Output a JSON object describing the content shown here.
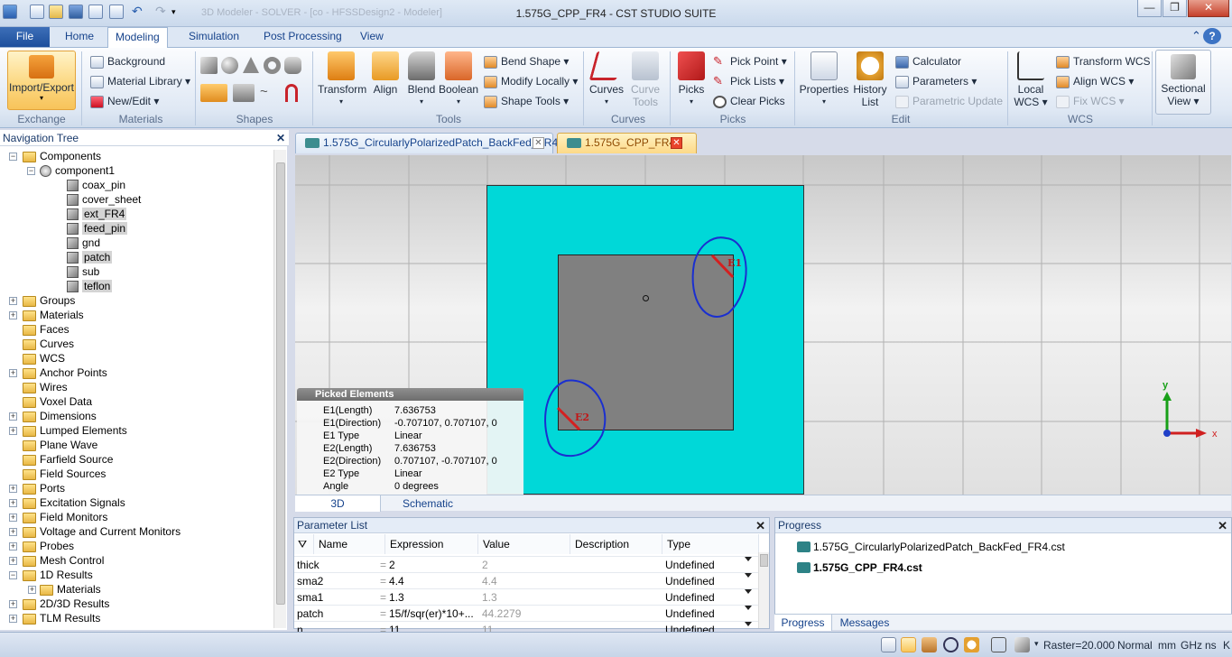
{
  "window": {
    "title": "1.575G_CPP_FR4 - CST STUDIO SUITE",
    "ghost_title": "3D Modeler - SOLVER - [co - HFSSDesign2 - Modeler]",
    "min": "—",
    "max": "❐",
    "close": "✕"
  },
  "ribbon_tabs": [
    "File",
    "Home",
    "Modeling",
    "Simulation",
    "Post Processing",
    "View"
  ],
  "ribbon_right": {
    "collapse": "⌃",
    "help": "?"
  },
  "ribbon": {
    "exchange": {
      "import_export": "Import/Export",
      "label": "Exchange"
    },
    "materials": {
      "background": "Background",
      "material_library": "Material Library",
      "new_edit": "New/Edit",
      "label": "Materials"
    },
    "shapes": {
      "label": "Shapes"
    },
    "tools": {
      "transform": "Transform",
      "align": "Align",
      "blend": "Blend",
      "boolean": "Boolean",
      "bend_shape": "Bend Shape",
      "modify_locally": "Modify Locally",
      "shape_tools": "Shape Tools",
      "label": "Tools"
    },
    "curves": {
      "curves": "Curves",
      "curve_tools_1": "Curve",
      "curve_tools_2": "Tools",
      "label": "Curves"
    },
    "picks": {
      "picks": "Picks",
      "pick_point": "Pick Point",
      "pick_lists": "Pick Lists",
      "clear_picks": "Clear Picks",
      "label": "Picks"
    },
    "edit": {
      "properties": "Properties",
      "history_list_1": "History",
      "history_list_2": "List",
      "calculator": "Calculator",
      "parameters": "Parameters",
      "parametric_update": "Parametric Update",
      "label": "Edit"
    },
    "wcs": {
      "local_wcs_1": "Local",
      "local_wcs_2": "WCS",
      "transform_wcs": "Transform WCS",
      "align_wcs": "Align WCS",
      "fix_wcs": "Fix WCS",
      "label": "WCS"
    },
    "sectional": {
      "l1": "Sectional",
      "l2": "View"
    }
  },
  "nav_tree": {
    "title": "Navigation Tree",
    "close": "✕",
    "components": "Components",
    "component1": "component1",
    "solids": [
      "coax_pin",
      "cover_sheet",
      "ext_FR4",
      "feed_pin",
      "gnd",
      "patch",
      "sub",
      "teflon"
    ],
    "folders": [
      "Groups",
      "Materials",
      "Faces",
      "Curves",
      "WCS",
      "Anchor Points",
      "Wires",
      "Voxel Data",
      "Dimensions",
      "Lumped Elements",
      "Plane Wave",
      "Farfield Source",
      "Field Sources",
      "Ports",
      "Excitation Signals",
      "Field Monitors",
      "Voltage and Current Monitors",
      "Probes",
      "Mesh Control",
      "1D Results",
      "2D/3D Results",
      "TLM Results"
    ],
    "sub_materials": "Materials"
  },
  "doc_tabs": [
    {
      "label": "1.575G_CircularlyPolarizedPatch_BackFed_FR4",
      "close": "✕"
    },
    {
      "label": "1.575G_CPP_FR4*",
      "close": "✕"
    }
  ],
  "viewport": {
    "e1_label": "E1",
    "e2_label": "E2",
    "axis_y": "y",
    "axis_x": "x"
  },
  "picked_elements": {
    "title": "Picked Elements",
    "rows": [
      {
        "k": "E1(Length)",
        "v": "7.636753"
      },
      {
        "k": "E1(Direction)",
        "v": "-0.707107, 0.707107, 0"
      },
      {
        "k": "E1 Type",
        "v": "Linear"
      },
      {
        "k": "E2(Length)",
        "v": "7.636753"
      },
      {
        "k": "E2(Direction)",
        "v": "0.707107, -0.707107, 0"
      },
      {
        "k": "E2 Type",
        "v": "Linear"
      },
      {
        "k": "Angle",
        "v": "0 degrees"
      }
    ]
  },
  "view_tabs": [
    "3D",
    "Schematic"
  ],
  "parameter_list": {
    "title": "Parameter List",
    "close": "✕",
    "columns": [
      "Name",
      "Expression",
      "Value",
      "Description",
      "Type"
    ],
    "rows": [
      {
        "name": "thick",
        "expr": "2",
        "value": "2",
        "type": "Undefined"
      },
      {
        "name": "sma2",
        "expr": "4.4",
        "value": "4.4",
        "type": "Undefined"
      },
      {
        "name": "sma1",
        "expr": "1.3",
        "value": "1.3",
        "type": "Undefined"
      },
      {
        "name": "patch",
        "expr": "15/f/sqr(er)*10+...",
        "value": "44.2279",
        "type": "Undefined"
      },
      {
        "name": "n",
        "expr": "11",
        "value": "11",
        "type": "Undefined"
      }
    ],
    "eq": "="
  },
  "progress": {
    "title": "Progress",
    "close": "✕",
    "files": [
      "1.575G_CircularlyPolarizedPatch_BackFed_FR4.cst",
      "1.575G_CPP_FR4.cst"
    ],
    "tabs": [
      "Progress",
      "Messages"
    ]
  },
  "status_bar": {
    "raster": "Raster=20.000",
    "mode": "Normal",
    "units": [
      "mm",
      "GHz",
      "ns",
      "K"
    ]
  },
  "colors": {
    "substrate": "#00d8d8",
    "patch": "#808080",
    "pick_edge": "#d42020",
    "annotation": "#1a2fd0"
  }
}
